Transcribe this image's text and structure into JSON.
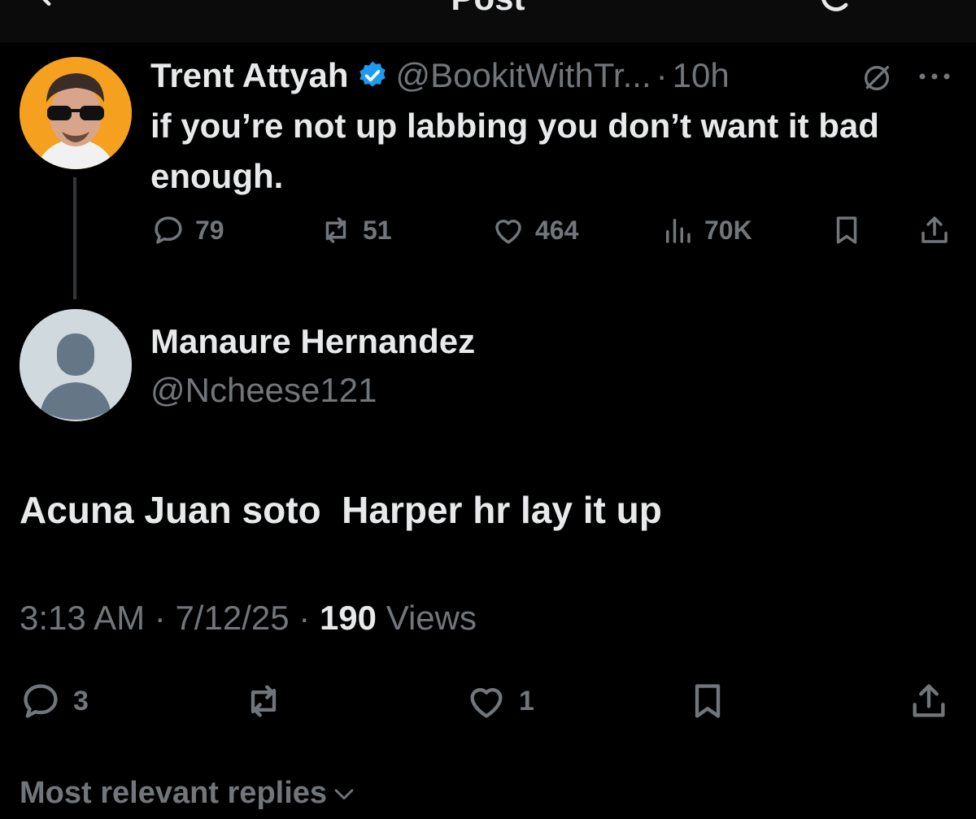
{
  "header": {
    "title": "Post"
  },
  "parent_post": {
    "author_name": "Trent Attyah",
    "handle": "@BookitWithTr...",
    "separator": "·",
    "time": "10h",
    "text": "if you’re not up labbing you don’t want it bad enough.",
    "stats": {
      "replies": "79",
      "reposts": "51",
      "likes": "464",
      "views": "70K"
    }
  },
  "reply_post": {
    "author_name": "Manaure Hernandez",
    "handle": "@Ncheese121",
    "text": "Acuna Juan soto  Harper hr lay it up",
    "time": "3:13 AM",
    "date": "7/12/25",
    "separator": "·",
    "views_count": "190",
    "views_label": "Views",
    "stats": {
      "replies": "3",
      "likes": "1"
    }
  },
  "replies_sort": {
    "label": "Most relevant replies"
  },
  "colors": {
    "background": "#000000",
    "text_primary": "#e7e9ea",
    "text_secondary": "#71767b",
    "verified_badge": "#1d9bf0",
    "avatar_bg_parent": "#f5a11f",
    "avatar_bg_default": "#cfd9de"
  },
  "icons": {
    "back": "back-arrow-icon",
    "refresh": "refresh-icon",
    "verified": "verified-badge-icon",
    "grok": "grok-icon",
    "more": "more-icon",
    "reply": "reply-icon",
    "repost": "repost-icon",
    "like": "like-icon",
    "views": "views-icon",
    "bookmark": "bookmark-icon",
    "share": "share-icon",
    "chevron": "chevron-down-icon"
  }
}
